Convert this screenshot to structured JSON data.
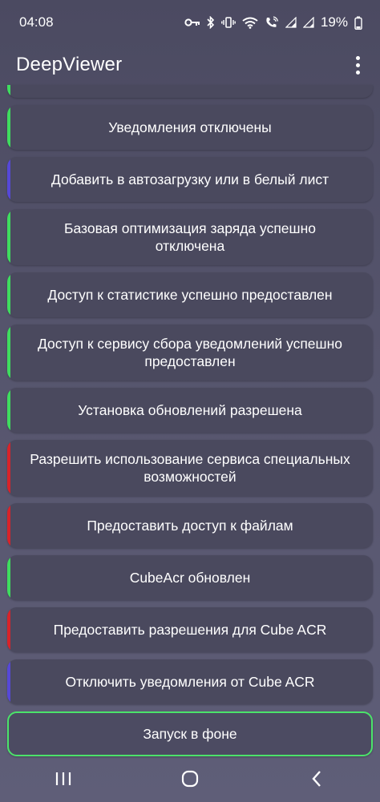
{
  "status_bar": {
    "time": "04:08",
    "battery": "19%",
    "icons": [
      "key-icon",
      "bluetooth-icon",
      "vibrate-icon",
      "wifi-icon",
      "wifi-calling-icon",
      "signal-icon",
      "signal-icon",
      "battery-icon"
    ]
  },
  "app": {
    "title": "DeepViewer",
    "menu_icon": "more-vert-icon"
  },
  "colors": {
    "success": "#3fdc5f",
    "error": "#d8232a",
    "info": "#5648d8"
  },
  "items": [
    {
      "label": "",
      "status": "success"
    },
    {
      "label": "Уведомления отключены",
      "status": "success"
    },
    {
      "label": "Добавить в автозагрузку или в белый лист",
      "status": "info"
    },
    {
      "label": "Базовая оптимизация заряда успешно отключена",
      "status": "success"
    },
    {
      "label": "Доступ к статистике успешно предоставлен",
      "status": "success"
    },
    {
      "label": "Доступ к сервису сбора уведомлений успешно предоставлен",
      "status": "success"
    },
    {
      "label": "Установка обновлений разрешена",
      "status": "success"
    },
    {
      "label": "Разрешить использование сервиса специальных возможностей",
      "status": "error"
    },
    {
      "label": "Предоставить доступ к файлам",
      "status": "error"
    },
    {
      "label": "CubeAcr обновлен",
      "status": "success"
    },
    {
      "label": "Предоставить разрешения для Cube ACR",
      "status": "error"
    },
    {
      "label": "Отключить уведомления от Cube ACR",
      "status": "info"
    },
    {
      "label": "Запуск в фоне",
      "status": "outlined"
    }
  ],
  "nav": {
    "icons": [
      "recent-apps-icon",
      "home-icon",
      "back-icon"
    ]
  }
}
